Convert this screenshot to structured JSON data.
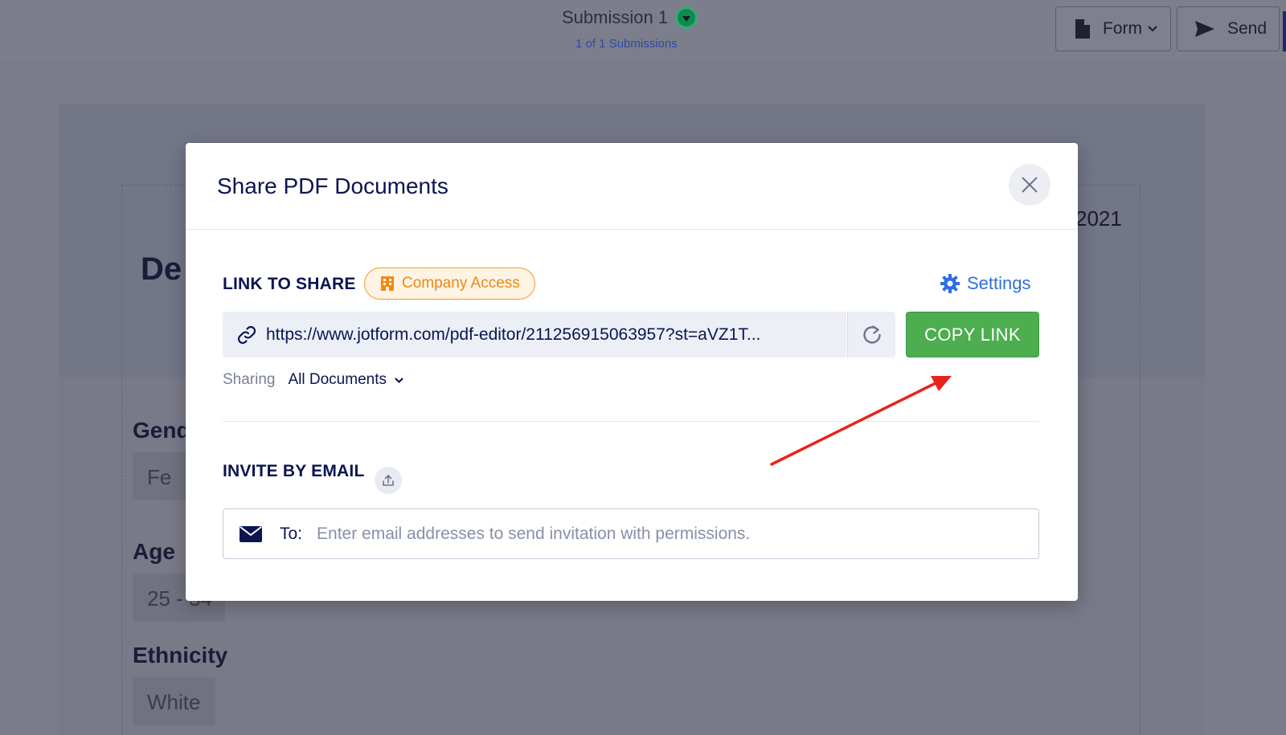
{
  "background": {
    "submission_title": "Submission 1",
    "submission_count": "1 of 1 Submissions",
    "form_button": "Form",
    "send_button": "Send",
    "year_fragment": "2021",
    "heading_fragment": "De",
    "fields": [
      {
        "label": "Gend",
        "value": "Fe"
      },
      {
        "label": "Age",
        "value": "25 - 34"
      },
      {
        "label": "Ethnicity",
        "value": "White"
      }
    ]
  },
  "modal": {
    "title": "Share PDF Documents",
    "link_section_label": "LINK TO SHARE",
    "access_badge": "Company Access",
    "settings_label": "Settings",
    "share_url": "https://www.jotform.com/pdf-editor/211256915063957?st=aVZ1T...",
    "copy_button": "COPY LINK",
    "sharing_label": "Sharing",
    "sharing_value": "All Documents",
    "invite_section_label": "INVITE BY EMAIL",
    "to_label": "To:",
    "email_placeholder": "Enter email addresses to send invitation with permissions."
  },
  "colors": {
    "accent_green": "#4cae4f",
    "badge_orange": "#e8891a",
    "link_blue": "#2f6fe0",
    "annotation_arrow": "#e8231b",
    "navy_text": "#0a1551"
  },
  "icons": [
    "document-icon",
    "chevron-down-icon",
    "send-icon",
    "close-icon",
    "building-icon",
    "gear-icon",
    "link-icon",
    "refresh-icon",
    "upload-icon",
    "envelope-icon",
    "annotation-arrow"
  ]
}
